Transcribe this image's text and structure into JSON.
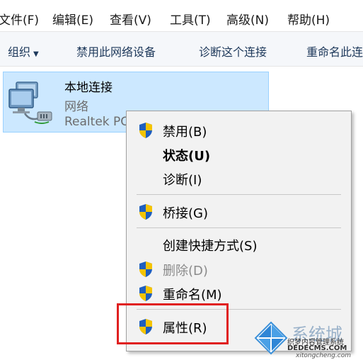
{
  "menubar": {
    "items": [
      "文件(F)",
      "编辑(E)",
      "查看(V)",
      "工具(T)",
      "高级(N)",
      "帮助(H)"
    ]
  },
  "commandbar": {
    "items": [
      "组织",
      "禁用此网络设备",
      "诊断这个连接",
      "重命名此连接"
    ]
  },
  "connection": {
    "name": "本地连接",
    "status": "网络",
    "device": "Realtek PC"
  },
  "context_menu": {
    "items": [
      {
        "label": "禁用(B)",
        "shield": true,
        "bold": false,
        "disabled": false
      },
      {
        "label": "状态(U)",
        "shield": false,
        "bold": true,
        "disabled": false
      },
      {
        "label": "诊断(I)",
        "shield": false,
        "bold": false,
        "disabled": false
      },
      {
        "label": "桥接(G)",
        "shield": true,
        "bold": false,
        "disabled": false
      },
      {
        "label": "创建快捷方式(S)",
        "shield": false,
        "bold": false,
        "disabled": false
      },
      {
        "label": "删除(D)",
        "shield": true,
        "bold": false,
        "disabled": true
      },
      {
        "label": "重命名(M)",
        "shield": true,
        "bold": false,
        "disabled": false
      },
      {
        "label": "属性(R)",
        "shield": true,
        "bold": false,
        "disabled": false
      }
    ]
  },
  "watermark": {
    "text": "系统城",
    "line1": "织梦内容管理系统",
    "line2": "DEDECMS.COM",
    "line3": "xitongcheng.com"
  },
  "colors": {
    "selection": "#cce8ff",
    "highlight_box": "#e02020",
    "shield_blue": "#1f5fbf",
    "shield_yellow": "#f5c400"
  }
}
